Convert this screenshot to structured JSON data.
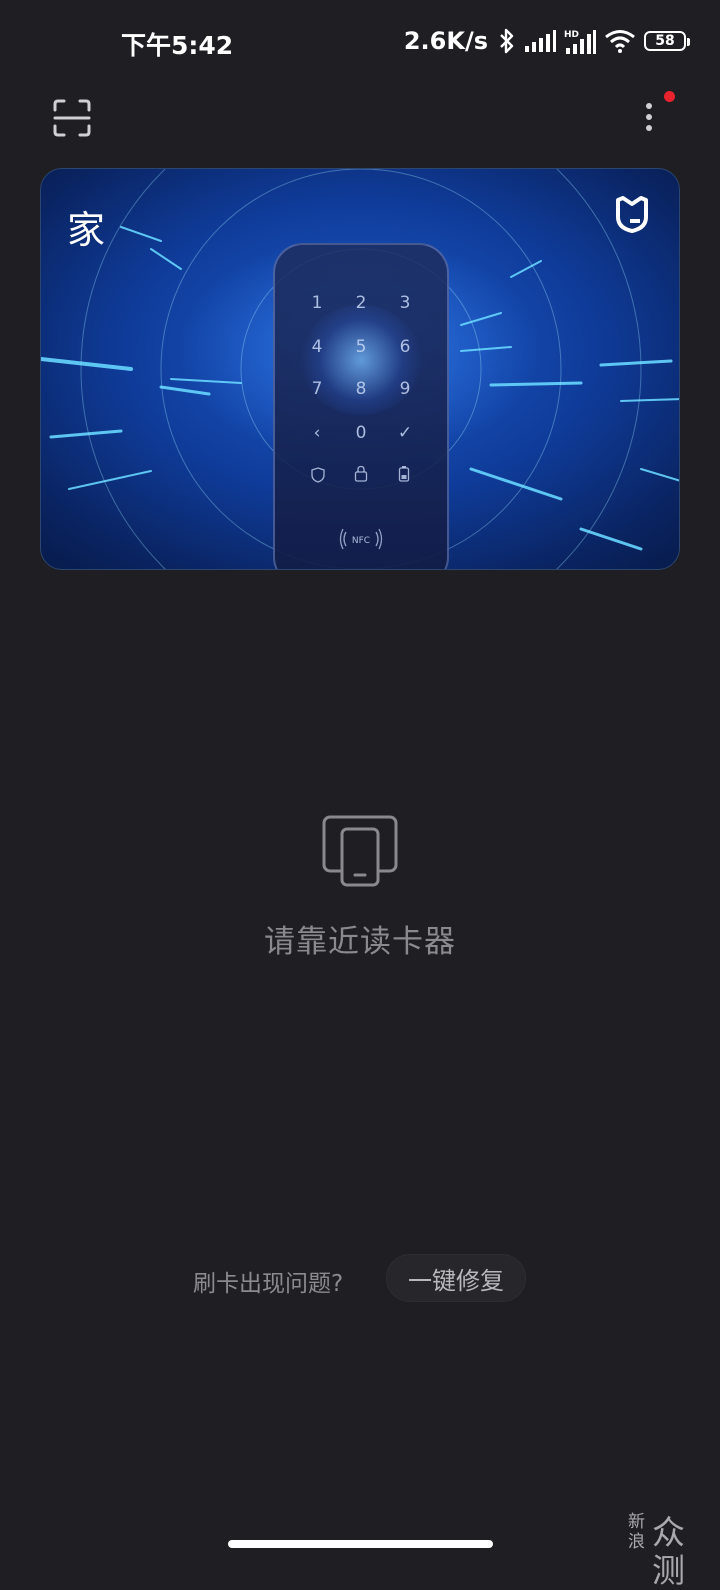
{
  "status_bar": {
    "time": "下午5:42",
    "net_speed": "2.6K/s",
    "battery": "58",
    "icons": [
      "bluetooth-icon",
      "signal-icon",
      "hd-signal-icon",
      "wifi-icon",
      "battery-icon"
    ]
  },
  "top_bar": {
    "left_icon": "scan-icon",
    "right_icon": "more-icon",
    "has_notification_dot": true
  },
  "card": {
    "title": "家",
    "brand_icon": "mi-logo-icon",
    "keypad": {
      "keys": [
        "1",
        "2",
        "3",
        "4",
        "5",
        "6",
        "7",
        "8",
        "9",
        "‹",
        "0",
        "✓"
      ],
      "nfc_label": "NFC"
    }
  },
  "reader": {
    "icon": "phone-card-icon",
    "prompt": "请靠近读卡器"
  },
  "footer": {
    "problem_text": "刷卡出现问题?",
    "fix_label": "一键修复"
  },
  "watermark": {
    "small": "新浪",
    "big": "众测"
  },
  "colors": {
    "background": "#1f1e23",
    "notification_dot": "#e8232d",
    "card_blue": "#1c5ac8"
  }
}
